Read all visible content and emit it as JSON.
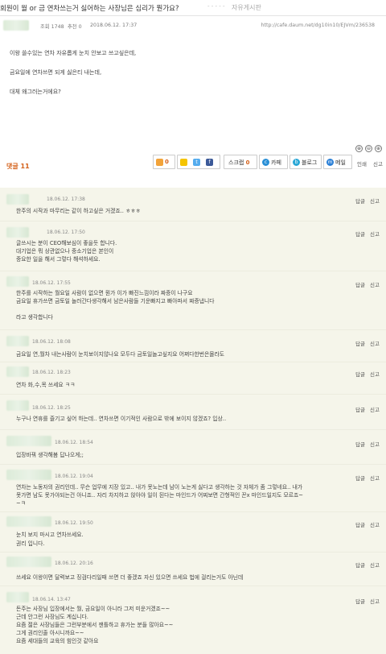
{
  "title": {
    "text": "회원이 월 or 금 연차쓰는거 싫어하는 사장님은 심리가 뭔가요?",
    "separator": "- - - - -",
    "board": "자유게시판"
  },
  "meta": {
    "views_label": "조회 1748",
    "recommend_label": "추천 0",
    "datetime": "2018.06.12. 17:37",
    "url": "http://cafe.daum.net/dg10in10/EJVm/236538"
  },
  "post": {
    "lines": [
      "이왕 쓸수있는 연차 자유롭게 눈치 안보고 쓰고싶은데,",
      "금요일에 연차쓰면 되게 싫은티 내는데,",
      "대체 왜그러는거에요?"
    ]
  },
  "zoom": {
    "a": "⊕",
    "b": "⊖",
    "c": "⊕"
  },
  "replies": {
    "label": "댓글",
    "count": "11"
  },
  "actions": {
    "like_count": "0",
    "twitter": "t",
    "facebook": "f",
    "scrap_label": "스크랩",
    "scrap_count": "0",
    "cafe_label": "카페",
    "blog_label": "블로그",
    "mail_label": "메일",
    "print_label": "인쇄",
    "report_label": "신고"
  },
  "comment_actions": {
    "reply": "답글",
    "report": "신고"
  },
  "comments": [
    {
      "date": "18.06.12. 17:38",
      "lines": [
        "한주의 시작과 마무리는 같이 하고싶은 거겠죠.. ㅎㅎㅎ"
      ]
    },
    {
      "date": "18.06.12. 17:50",
      "lines": [
        "글쓰시는 분이 CEO해보심이 좋을듯 합니다.",
        "대기업은 뭐 상관없으나 중소기업은 본인이",
        "중요한 일을 해서 그렇다 해석하세요."
      ]
    },
    {
      "date": "18.06.12. 17:55",
      "lines": [
        "한주를 시작하는 월요일 사람이 없으면 뭔가 이가 빠진느낌이라 짜증이 나구요",
        "금요일 휴가쓰면 금토일 놀러간다생각해서 남은사람들 기운빠지고 빠아파서 짜증냅니다",
        "",
        "라고 생각합니다"
      ]
    },
    {
      "date": "18.06.12. 18:08",
      "lines": [
        "금요일 연,월차 내는사람이 눈치보이지않나요 모두다 금토일놀고싶지요 어쩌다한번은몰라도"
      ]
    },
    {
      "date": "18.06.12. 18:23",
      "lines": [
        "연차 화,수,목 쓰세요 ㅋㅋ"
      ]
    },
    {
      "date": "18.06.12. 18:25",
      "lines": [
        "누구나 연휴를 즐기고 싶어 하는데.. 연차쓰면 이기적인 사람으로 밖에 보이지 않겠죠? 입상.."
      ]
    },
    {
      "date": "18.06.12. 18:54",
      "lines": [
        "입장바꿔 생각해봄 답나오게;;"
      ]
    },
    {
      "date": "18.06.12. 19:04",
      "lines": [
        "연차는 노동자의 권리인데.. 무슨 업무에 지장 있고.. 내가 못노는데 남이 노는게 싫다고 생각하는 것 자체가 좀 그렇네요.. 내가",
        "못가면 남도 못가야되는건 아니죠.. 자리 차지하고 앉아야 일이 된다는 마인드가 어찌보면 간형적인 꼰x 마인드일지도 모르죠~",
        "~ㅋ"
      ]
    },
    {
      "date": "18.06.12. 19:50",
      "lines": [
        "눈치 보지 마시고 연차쓰세요.",
        "권리 입니다."
      ]
    },
    {
      "date": "18.06.12. 20:16",
      "lines": [
        "쓰세요 이왕이면 달력보고 징검다리일때 쓰면 더 좋겠죠 자신 있으면 쓰세요 법에 걸리는거도 아닌데"
      ]
    },
    {
      "date": "18.06.14. 13:47",
      "lines": [
        "돈주는 사장님 입장에서는 월, 금요일이 아니라 그저 미운거겠죠~~",
        "근데 안그런 사장님도 계십니다.",
        "요즘 젊은 사장님들은 그런부분에서 잰틀하고 휴가는 분들 많아요~~",
        "그게 권리인줄 아시니까요~~",
        "요즘 세대들의 교육의 힘인것 같아요"
      ]
    }
  ]
}
